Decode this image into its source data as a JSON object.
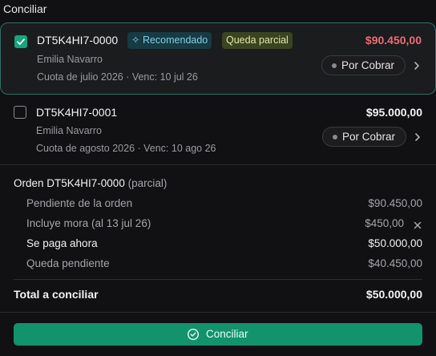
{
  "section_title": "Conciliar",
  "items": [
    {
      "code": "DT5K4HI7-0000",
      "client": "Emilia Navarro",
      "cuota": "Cuota de julio 2026 · Venc: 10 jul 26",
      "badge_recommended": "✧ Recomendado",
      "badge_partial": "Queda parcial",
      "amount": "$90.450,00",
      "status": "Por Cobrar",
      "checked": true
    },
    {
      "code": "DT5K4HI7-0001",
      "client": "Emilia Navarro",
      "cuota": "Cuota de agosto 2026 · Venc: 10 ago 26",
      "amount": "$95.000,00",
      "status": "Por Cobrar",
      "checked": false
    }
  ],
  "summary": {
    "title": "Orden DT5K4HI7-0000",
    "title_suffix": "(parcial)",
    "rows": [
      {
        "label": "Pendiente de la orden",
        "value": "$90.450,00"
      },
      {
        "label": "Incluye mora (al 13 jul 26)",
        "value": "$450,00"
      },
      {
        "label": "Se paga ahora",
        "value": "$50.000,00"
      },
      {
        "label": "Queda pendiente",
        "value": "$40.450,00"
      }
    ],
    "total_label": "Total a conciliar",
    "total_value": "$50.000,00"
  },
  "action": {
    "label": "Conciliar"
  },
  "colors": {
    "accent": "#12936b",
    "danger": "#ee6b77",
    "selected_border": "#2f6f66"
  }
}
